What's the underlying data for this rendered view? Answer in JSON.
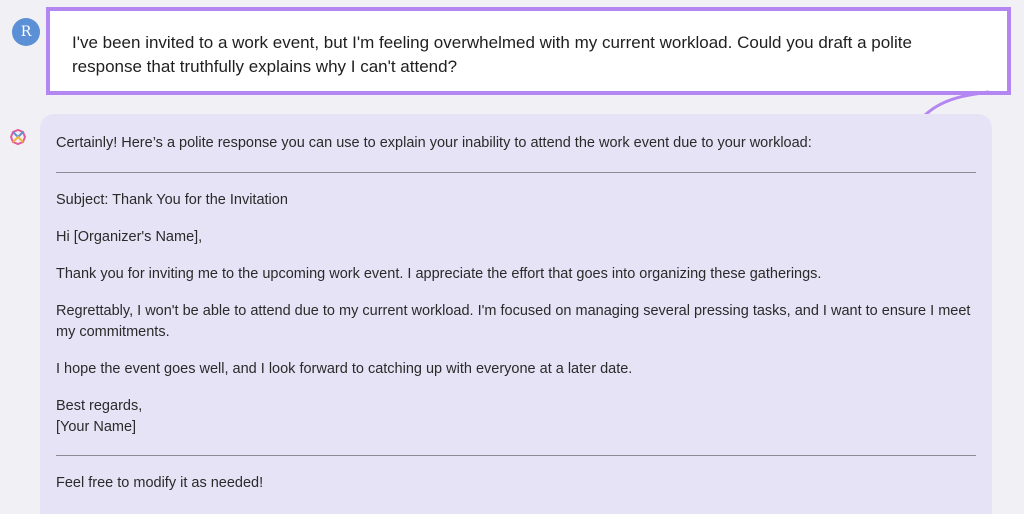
{
  "user": {
    "avatar_initial": "R",
    "prompt": "I've been invited to a work event, but I'm feeling overwhelmed with my current workload. Could you draft a polite response that truthfully explains why I can't attend?"
  },
  "assistant": {
    "icon": "gemini-sparkle-icon",
    "intro": "Certainly! Here’s a polite response you can use to explain your inability to attend the work event due to your workload:",
    "subject": "Subject: Thank You for the Invitation",
    "greeting": "Hi [Organizer's Name],",
    "paragraph1": "Thank you for inviting me to the upcoming work event. I appreciate the effort that goes into organizing these gatherings.",
    "paragraph2": "Regrettably, I won't be able to attend due to my current workload. I'm focused on managing several pressing tasks, and I want to ensure I meet my commitments.",
    "paragraph3": "I hope the event goes well, and I look forward to catching up with everyone at a later date.",
    "signoff": "Best regards,",
    "signature": "[Your Name]",
    "closing": "Feel free to modify it as needed!"
  },
  "colors": {
    "highlight_border": "#b486f2",
    "response_bg": "#e7e3f6",
    "avatar_bg": "#5b8fd6",
    "page_bg": "#f1f0f4"
  }
}
